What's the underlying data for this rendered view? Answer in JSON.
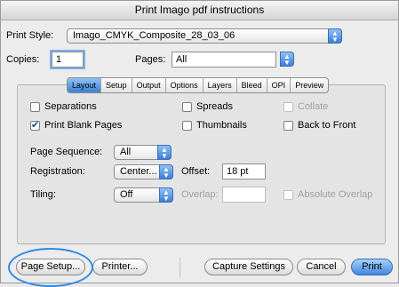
{
  "window": {
    "title": "Print Imago pdf instructions"
  },
  "print_style": {
    "label": "Print Style:",
    "value": "Imago_CMYK_Composite_28_03_06"
  },
  "copies": {
    "label": "Copies:",
    "value": "1"
  },
  "pages": {
    "label": "Pages:",
    "value": "All"
  },
  "tabs": [
    {
      "label": "Layout",
      "selected": true
    },
    {
      "label": "Setup"
    },
    {
      "label": "Output"
    },
    {
      "label": "Options"
    },
    {
      "label": "Layers"
    },
    {
      "label": "Bleed"
    },
    {
      "label": "OPI"
    },
    {
      "label": "Preview"
    }
  ],
  "options": {
    "separations": {
      "label": "Separations",
      "checked": false
    },
    "spreads": {
      "label": "Spreads",
      "checked": false
    },
    "collate": {
      "label": "Collate",
      "checked": false,
      "disabled": true
    },
    "print_blank_pages": {
      "label": "Print Blank Pages",
      "checked": true
    },
    "thumbnails": {
      "label": "Thumbnails",
      "checked": false
    },
    "back_to_front": {
      "label": "Back to Front",
      "checked": false
    }
  },
  "page_sequence": {
    "label": "Page Sequence:",
    "value": "All"
  },
  "registration": {
    "label": "Registration:",
    "value": "Center...",
    "offset_label": "Offset:",
    "offset_value": "18 pt"
  },
  "tiling": {
    "label": "Tiling:",
    "value": "Off",
    "overlap_label": "Overlap:",
    "overlap_value": "",
    "absolute_overlap_label": "Absolute Overlap"
  },
  "buttons": {
    "page_setup": "Page Setup...",
    "printer": "Printer...",
    "capture_settings": "Capture Settings",
    "cancel": "Cancel",
    "print": "Print"
  },
  "colors": {
    "accent": "#3a7fd8",
    "highlight_ring": "#2e8be6"
  },
  "icons": {
    "popup_arrows": "up-down-arrows-icon",
    "checkmark": "checkmark-icon"
  }
}
